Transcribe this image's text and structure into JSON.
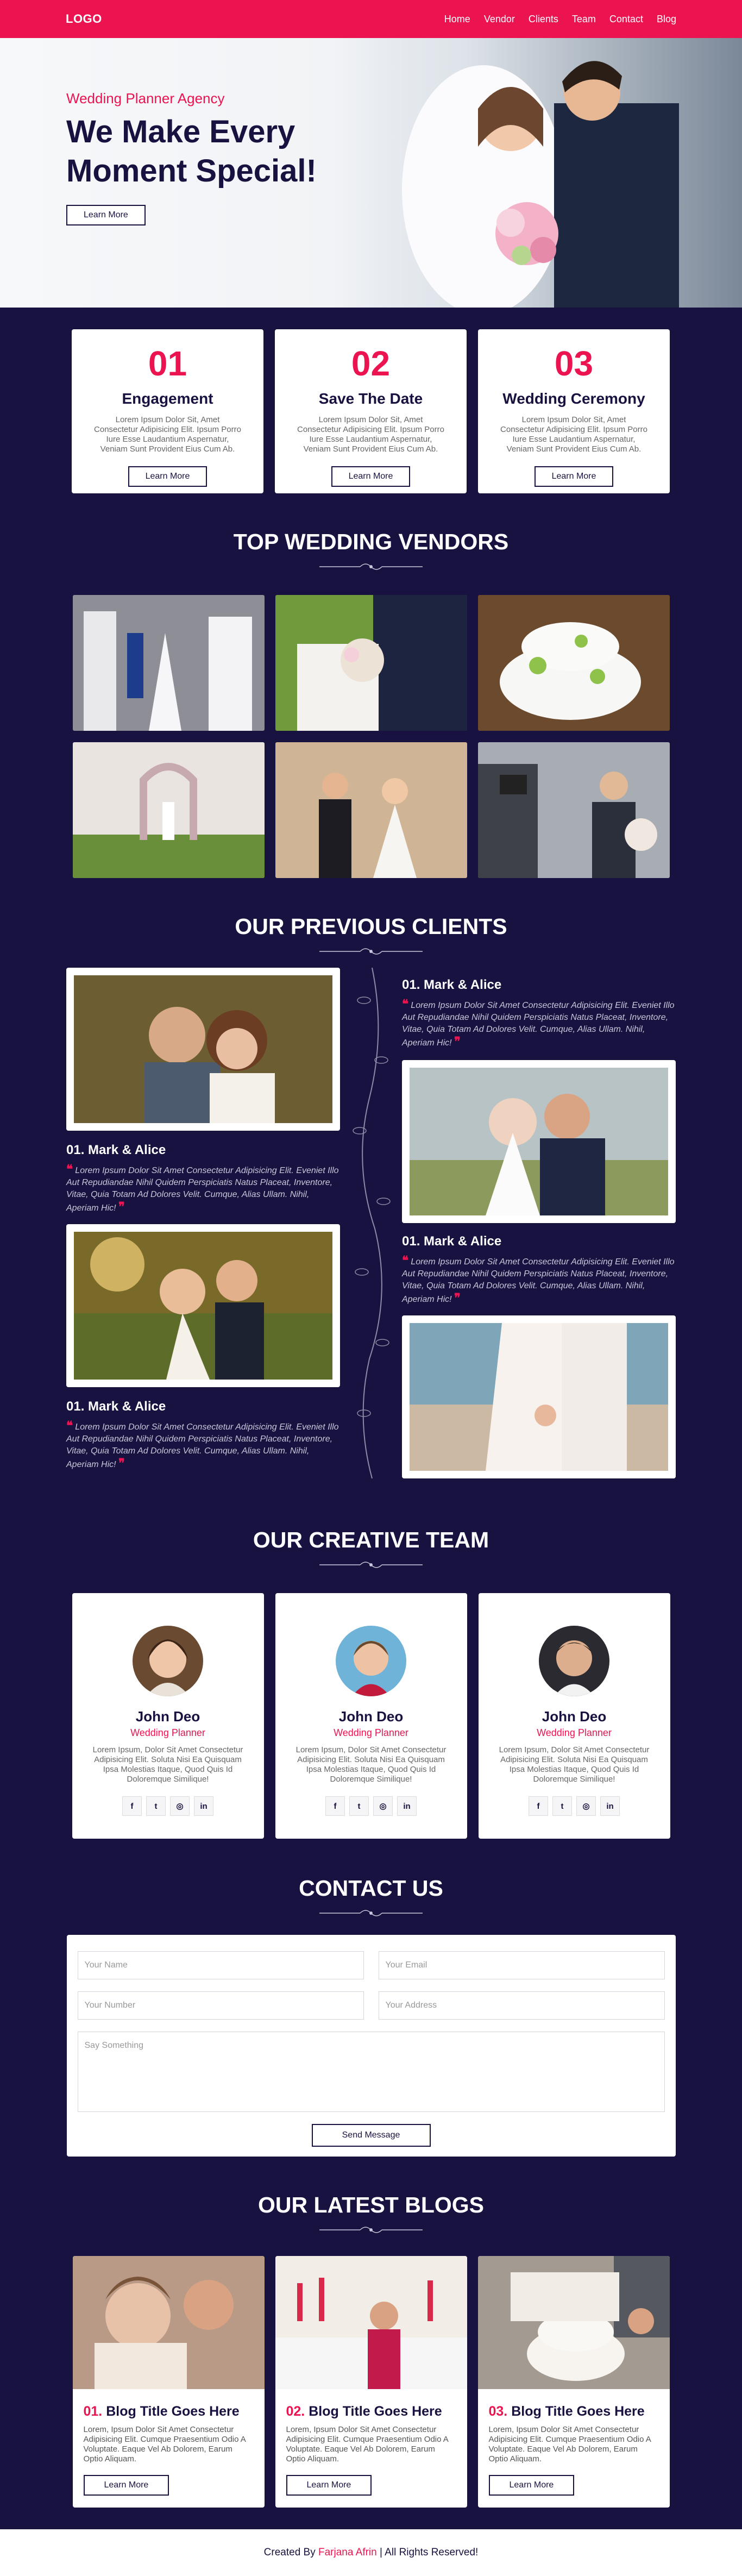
{
  "nav": {
    "logo": "LOGO",
    "links": [
      "Home",
      "Vendor",
      "Clients",
      "Team",
      "Contact",
      "Blog"
    ]
  },
  "hero": {
    "subtitle": "Wedding Planner Agency",
    "title": "We Make Every Moment Special!",
    "button": "Learn More"
  },
  "steps": [
    {
      "number": "01",
      "title": "Engagement",
      "text": "Lorem Ipsum Dolor Sit, Amet Consectetur Adipisicing Elit. Ipsum Porro Iure Esse Laudantium Aspernatur, Veniam Sunt Provident Eius Cum Ab.",
      "button": "Learn More"
    },
    {
      "number": "02",
      "title": "Save The Date",
      "text": "Lorem Ipsum Dolor Sit, Amet Consectetur Adipisicing Elit. Ipsum Porro Iure Esse Laudantium Aspernatur, Veniam Sunt Provident Eius Cum Ab.",
      "button": "Learn More"
    },
    {
      "number": "03",
      "title": "Wedding Ceremony",
      "text": "Lorem Ipsum Dolor Sit, Amet Consectetur Adipisicing Elit. Ipsum Porro Iure Esse Laudantium Aspernatur, Veniam Sunt Provident Eius Cum Ab.",
      "button": "Learn More"
    }
  ],
  "vendors": {
    "title": "TOP WEDDING VENDORS"
  },
  "clients": {
    "title": "OUR PREVIOUS CLIENTS",
    "items": [
      {
        "name": "01. Mark & Alice",
        "quote": "Lorem Ipsum Dolor Sit Amet Consectetur Adipisicing Elit. Eveniet Illo Aut Repudiandae Nihil Quidem Perspiciatis Natus Placeat, Inventore, Vitae, Quia Totam Ad Dolores Velit. Cumque, Alias Ullam. Nihil, Aperiam Hic!"
      },
      {
        "name": "01. Mark & Alice",
        "quote": "Lorem Ipsum Dolor Sit Amet Consectetur Adipisicing Elit. Eveniet Illo Aut Repudiandae Nihil Quidem Perspiciatis Natus Placeat, Inventore, Vitae, Quia Totam Ad Dolores Velit. Cumque, Alias Ullam. Nihil, Aperiam Hic!"
      },
      {
        "name": "01. Mark & Alice",
        "quote": "Lorem Ipsum Dolor Sit Amet Consectetur Adipisicing Elit. Eveniet Illo Aut Repudiandae Nihil Quidem Perspiciatis Natus Placeat, Inventore, Vitae, Quia Totam Ad Dolores Velit. Cumque, Alias Ullam. Nihil, Aperiam Hic!"
      },
      {
        "name": "01. Mark & Alice",
        "quote": "Lorem Ipsum Dolor Sit Amet Consectetur Adipisicing Elit. Eveniet Illo Aut Repudiandae Nihil Quidem Perspiciatis Natus Placeat, Inventore, Vitae, Quia Totam Ad Dolores Velit. Cumque, Alias Ullam. Nihil, Aperiam Hic!"
      }
    ]
  },
  "team": {
    "title": "OUR CREATIVE TEAM",
    "members": [
      {
        "name": "John Deo",
        "role": "Wedding Planner",
        "text": "Lorem Ipsum, Dolor Sit Amet Consectetur Adipisicing Elit. Soluta Nisi Ea Quisquam Ipsa Molestias Itaque, Quod Quis Id Doloremque Similique!"
      },
      {
        "name": "John Deo",
        "role": "Wedding Planner",
        "text": "Lorem Ipsum, Dolor Sit Amet Consectetur Adipisicing Elit. Soluta Nisi Ea Quisquam Ipsa Molestias Itaque, Quod Quis Id Doloremque Similique!"
      },
      {
        "name": "John Deo",
        "role": "Wedding Planner",
        "text": "Lorem Ipsum, Dolor Sit Amet Consectetur Adipisicing Elit. Soluta Nisi Ea Quisquam Ipsa Molestias Itaque, Quod Quis Id Doloremque Similique!"
      }
    ],
    "social_icons": [
      "facebook-icon",
      "twitter-icon",
      "instagram-icon",
      "linkedin-icon"
    ],
    "social_glyphs": [
      "f",
      "t",
      "◎",
      "in"
    ]
  },
  "contact": {
    "title": "CONTACT US",
    "name_placeholder": "Your Name",
    "email_placeholder": "Your Email",
    "number_placeholder": "Your Number",
    "address_placeholder": "Your Address",
    "message_placeholder": "Say Something",
    "button": "Send Message"
  },
  "blogs": {
    "title": "OUR LATEST BLOGS",
    "posts": [
      {
        "number": "01.",
        "title": "Blog Title Goes Here",
        "text": "Lorem, Ipsum Dolor Sit Amet Consectetur Adipisicing Elit. Cumque Praesentium Odio A Voluptate. Eaque Vel Ab Dolorem, Earum Optio Aliquam.",
        "button": "Learn More"
      },
      {
        "number": "02.",
        "title": "Blog Title Goes Here",
        "text": "Lorem, Ipsum Dolor Sit Amet Consectetur Adipisicing Elit. Cumque Praesentium Odio A Voluptate. Eaque Vel Ab Dolorem, Earum Optio Aliquam.",
        "button": "Learn More"
      },
      {
        "number": "03.",
        "title": "Blog Title Goes Here",
        "text": "Lorem, Ipsum Dolor Sit Amet Consectetur Adipisicing Elit. Cumque Praesentium Odio A Voluptate. Eaque Vel Ab Dolorem, Earum Optio Aliquam.",
        "button": "Learn More"
      }
    ]
  },
  "footer": {
    "prefix": "Created By",
    "author": "Farjana Afrin",
    "suffix": "| All Rights Reserved!"
  },
  "colors": {
    "accent": "#eb1450",
    "navy": "#17123f",
    "white": "#ffffff"
  }
}
